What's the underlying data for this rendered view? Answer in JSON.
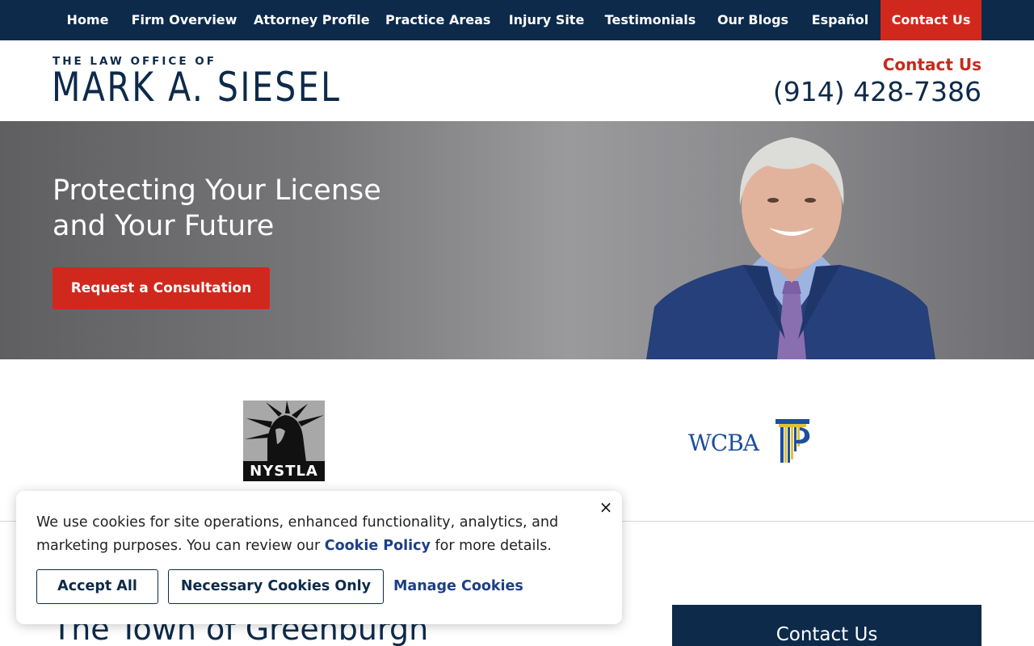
{
  "nav": {
    "items": [
      {
        "label": "Home"
      },
      {
        "label": "Firm Overview"
      },
      {
        "label": "Attorney Profile"
      },
      {
        "label": "Practice Areas"
      },
      {
        "label": "Injury Site"
      },
      {
        "label": "Testimonials"
      },
      {
        "label": "Our Blogs"
      },
      {
        "label": "Español"
      },
      {
        "label": "Contact Us"
      }
    ],
    "active": "Contact Us"
  },
  "header": {
    "logo_small": "THE LAW OFFICE OF",
    "logo_big": "MARK A. SIESEL",
    "contact_label": "Contact Us",
    "phone": "(914) 428-7386"
  },
  "hero": {
    "title_line1": "Protecting Your License",
    "title_line2": "and Your Future",
    "cta_label": "Request a Consultation"
  },
  "affiliations": {
    "nystla": "NYSTLA",
    "wcba": "WCBA"
  },
  "main": {
    "heading": "The Town of Greenburgh"
  },
  "sidebar": {
    "contact_title": "Contact Us"
  },
  "cookie": {
    "text_before": "We use cookies for site operations, enhanced functionality, analytics, and marketing purposes. You can review our ",
    "link": "Cookie Policy",
    "text_after": " for more details.",
    "accept_all": "Accept All",
    "necessary_only": "Necessary Cookies Only",
    "manage": "Manage Cookies",
    "close": "×"
  },
  "colors": {
    "navy": "#0d2a4a",
    "red": "#d1281e",
    "link_blue": "#1d3f85"
  }
}
